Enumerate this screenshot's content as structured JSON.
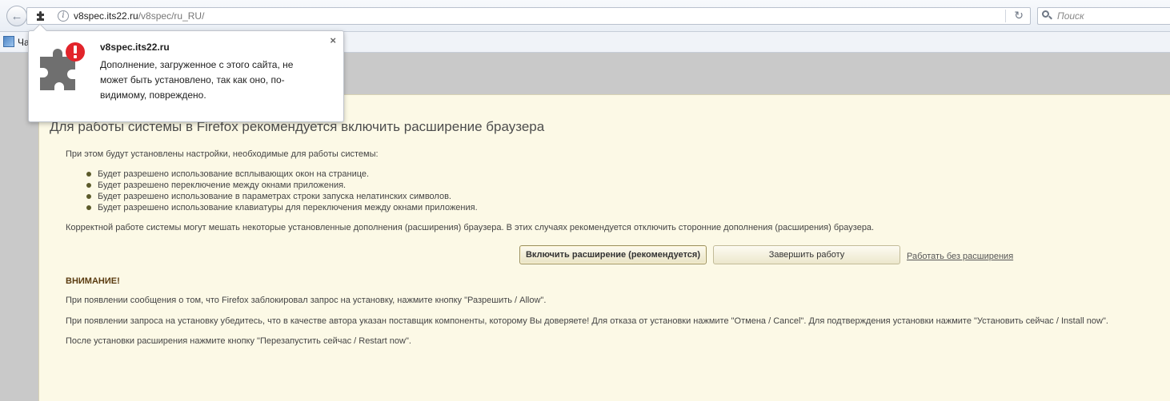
{
  "browser": {
    "url_host": "v8spec.its22.ru",
    "url_path": "/v8spec/ru_RU/",
    "search_placeholder": "Поиск",
    "bookmark_label": "Ча"
  },
  "popup": {
    "title": "v8spec.its22.ru",
    "message": "Дополнение, загруженное с этого сайта, не может быть установлено, так как оно, по-видимому, повреждено.",
    "close": "×"
  },
  "page": {
    "heading": "Для работы системы в Firefox рекомендуется включить расширение браузера",
    "intro": "При этом будут установлены настройки, необходимые для работы системы:",
    "bullets": [
      "Будет разрешено использование всплывающих окон на странице.",
      "Будет разрешено переключение между окнами приложения.",
      "Будет разрешено использование в параметрах строки запуска нелатинских символов.",
      "Будет разрешено использование клавиатуры для переключения между окнами приложения."
    ],
    "note": "Корректной работе системы могут мешать некоторые установленные дополнения (расширения) браузера. В этих случаях рекомендуется отключить сторонние дополнения (расширения) браузера.",
    "enable_button": "Включить расширение (рекомендуется)",
    "finish_button": "Завершить работу",
    "no_extension_link": "Работать без расширения",
    "warning_title": "ВНИМАНИЕ!",
    "para1": "При появлении сообщения о том, что Firefox заблокировал запрос на установку, нажмите кнопку \"Разрешить / Allow\".",
    "para2": "При появлении запроса на установку убедитесь, что в качестве автора указан поставщик компоненты, которому Вы доверяете! Для отказа от установки нажмите \"Отмена / Cancel\". Для подтверждения установки нажмите \"Установить сейчас / Install now\".",
    "para3": "После установки расширения нажмите кнопку \"Перезапустить сейчас / Restart now\"."
  },
  "colors": {
    "page_background": "#fcf9e6",
    "grey_band": "#c9c9c9",
    "error_badge": "#e2242b",
    "puzzle_grey": "#6f6f6f"
  }
}
